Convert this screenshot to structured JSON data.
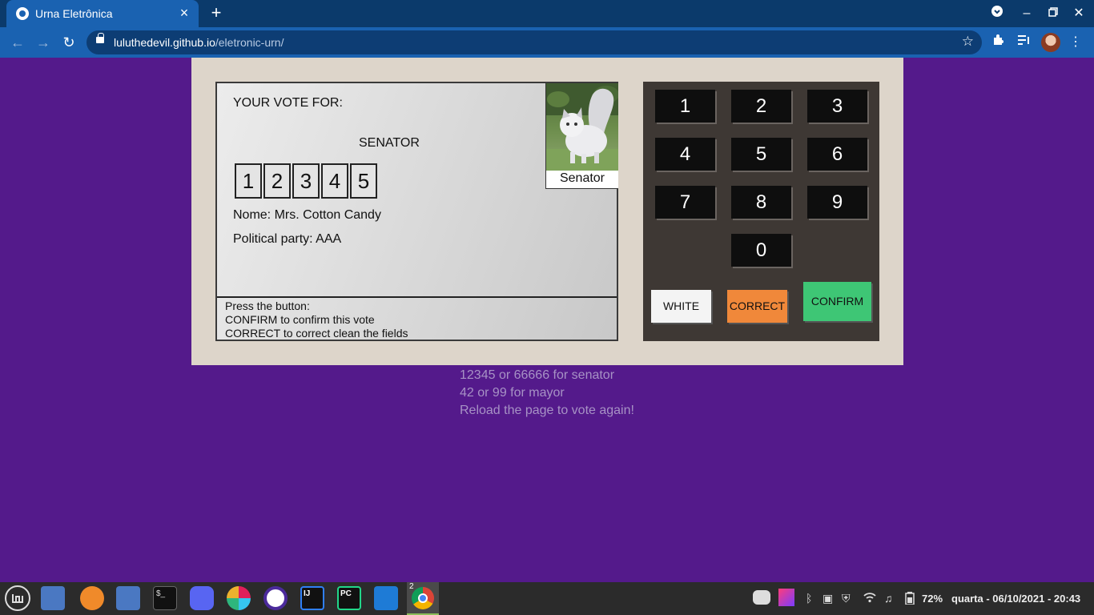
{
  "browser": {
    "tab_title": "Urna Eletrônica",
    "url_host": "luluthedevil.github.io",
    "url_path": "/eletronic-urn/"
  },
  "urn": {
    "screen": {
      "title": "YOUR VOTE FOR:",
      "role": "SENATOR",
      "digits": [
        "1",
        "2",
        "3",
        "4",
        "5"
      ],
      "name_line": "Nome: Mrs. Cotton Candy",
      "party_line": "Political party: AAA",
      "photo_caption": "Senator",
      "footer": [
        "Press the button:",
        "CONFIRM to confirm this vote",
        "CORRECT to correct clean the fields"
      ]
    },
    "keypad": {
      "keys": [
        "1",
        "2",
        "3",
        "4",
        "5",
        "6",
        "7",
        "8",
        "9",
        "0"
      ],
      "white_label": "WHITE",
      "correct_label": "CORRECT",
      "confirm_label": "CONFIRM"
    }
  },
  "hints": [
    "12345 or 66666 for senator",
    "42 or 99 for mayor",
    "Reload the page to vote again!"
  ],
  "taskbar": {
    "battery": "72%",
    "datetime": "quarta - 06/10/2021 - 20:43",
    "chrome_windows": "2"
  }
}
